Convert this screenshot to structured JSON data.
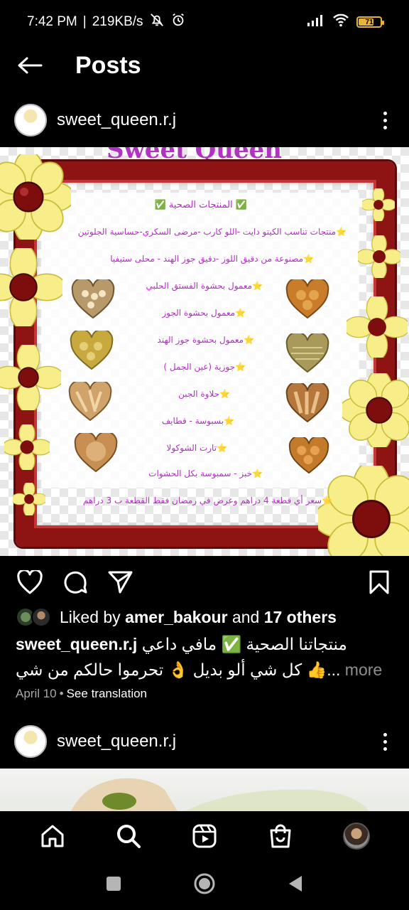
{
  "status_bar": {
    "time": "7:42 PM",
    "separator": "|",
    "speed": "219KB/s",
    "battery_level": "71",
    "battery_fraction": 0.71,
    "icons": [
      "mute-bell-icon",
      "alarm-icon",
      "signal-icon",
      "wifi-icon",
      "battery-icon"
    ]
  },
  "header": {
    "title": "Posts",
    "back_icon": "back-arrow-icon"
  },
  "post1": {
    "username": "sweet_queen.r.j",
    "image_title_partial": "Sweet Queen",
    "image_lines": {
      "heading": "✅ المنتجات الصحية ✅",
      "line1": "⭐منتجات تناسب الكيتو دايت -اللو كارب -مرضى السكري-حساسية الجلوتين",
      "line2": "⭐مصنوعة من دقيق اللوز -دقيق جوز الهند - محلى ستيفيا",
      "items": [
        "⭐معمول بحشوة الفستق الحلبي",
        "⭐معمول بحشوة الجوز",
        "⭐معمول بحشوة جوز الهند",
        "⭐جوزية (عين الجمل )",
        "⭐حلاوة الجبن",
        "⭐بسبوسة - قطايف",
        "⭐تارت الشوكولا",
        "⭐خبز - سمبوسة بكل الحشوات"
      ],
      "footer": "⭐سعر أي قطعة 4 دراهم وعرض في رمضان فقط القطعة ب 3 دراهم"
    },
    "liked_by_prefix": "Liked by",
    "liked_by_user": "amer_bakour",
    "liked_by_and": "and",
    "liked_by_others": "17 others",
    "caption_user": "sweet_queen.r.j",
    "caption_line1": "منتجاتنا الصحية ✅ مافي داعي",
    "caption_line2": "كل شي ألو بديل 👌 تحرموا حالكم من شي 👍...",
    "caption_more": "more",
    "date": "April 10",
    "date_sep": "•",
    "see_translation": "See translation"
  },
  "post2": {
    "username": "sweet_queen.r.j"
  },
  "bottom_nav": {
    "items": [
      "home-icon",
      "search-icon",
      "reels-icon",
      "shop-icon",
      "profile-avatar"
    ]
  },
  "colors": {
    "background": "#000000",
    "frame_red": "#8e1414",
    "flower_yellow": "#f7ee8a",
    "arabic_purple": "#b12ec2",
    "muted_text": "#a8a8a8",
    "battery": "#e7b43a"
  }
}
